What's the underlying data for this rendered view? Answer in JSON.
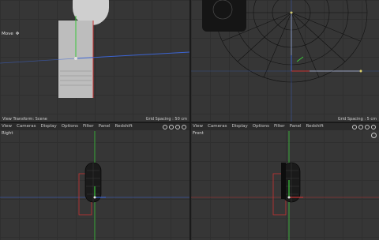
{
  "viewports": {
    "top_left": {
      "tool_label": "Move",
      "footer_left": "View Transform: Scene",
      "footer_right": "Grid Spacing : 50 cm"
    },
    "top_right": {
      "footer_right": "Grid Spacing : 5 cm"
    },
    "bottom_left": {
      "menu": [
        "View",
        "Cameras",
        "Display",
        "Options",
        "Filter",
        "Panel",
        "Redshift"
      ],
      "label": "Right"
    },
    "bottom_right": {
      "menu": [
        "View",
        "Cameras",
        "Display",
        "Options",
        "Filter",
        "Panel",
        "Redshift"
      ],
      "label": "Front"
    }
  },
  "colors": {
    "viewport_bg": "#363636",
    "axis_x": "#c83232",
    "axis_y": "#3cc83c",
    "axis_z": "#3c64d2",
    "selection": "#e0e0e0"
  },
  "icons": [
    "move-icon",
    "orbit-icon",
    "zoom-icon",
    "rotate-icon",
    "maximize-icon"
  ]
}
